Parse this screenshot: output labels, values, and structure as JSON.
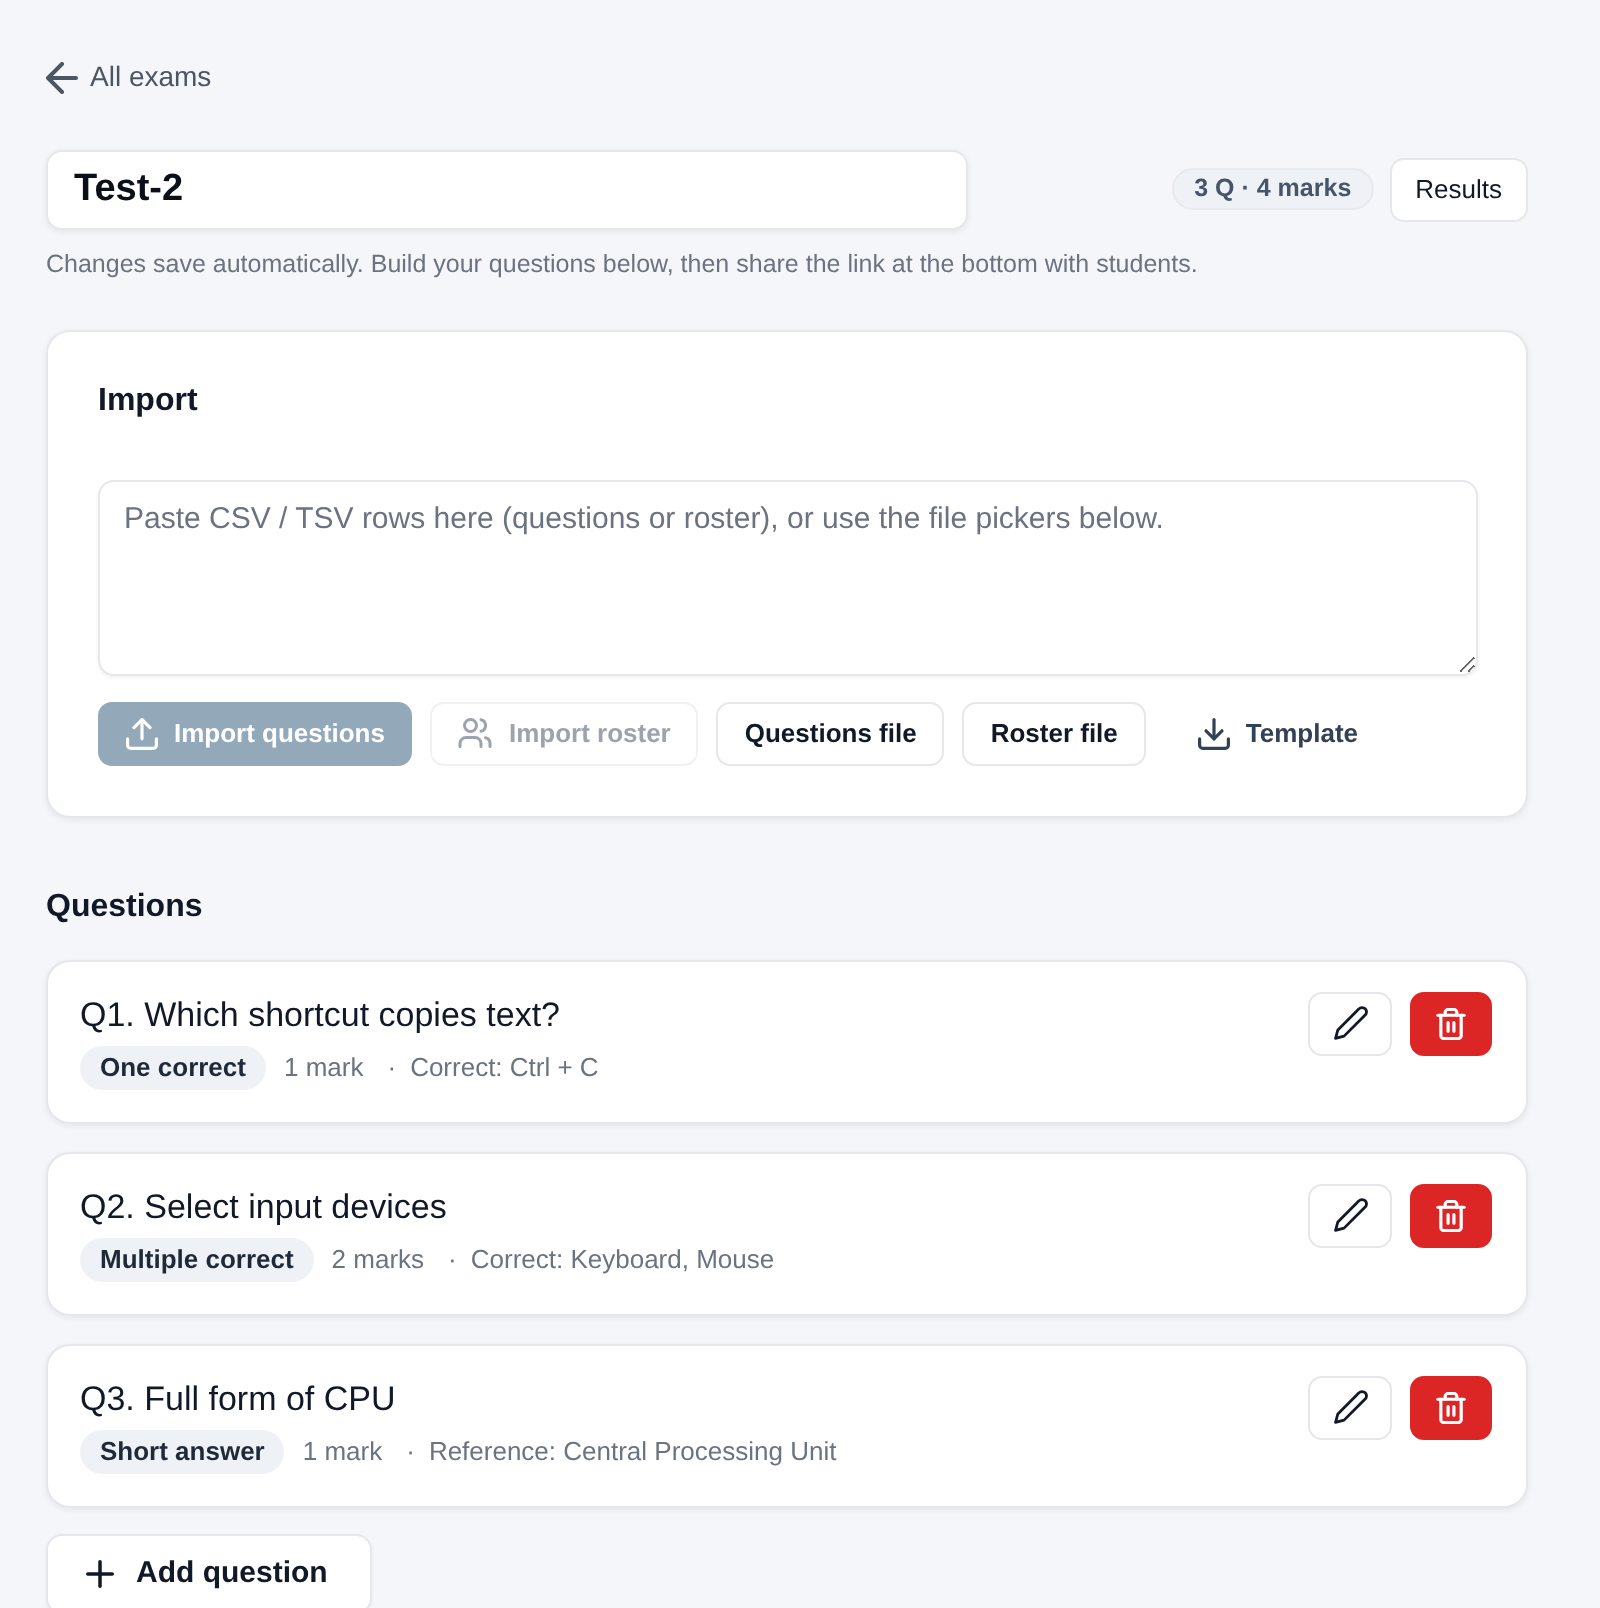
{
  "back_link": {
    "label": "All exams"
  },
  "exam": {
    "title": "Test-2",
    "summary": "3 Q · 4 marks",
    "results_button": "Results",
    "hint": "Changes save automatically. Build your questions below, then share the link at the bottom with students."
  },
  "import": {
    "heading": "Import",
    "placeholder": "Paste CSV / TSV rows here (questions or roster), or use the file pickers below.",
    "buttons": [
      {
        "label": "Import questions",
        "kind": "primary",
        "disabled": true
      },
      {
        "label": "Import roster",
        "kind": "secondary",
        "disabled": true
      },
      {
        "label": "Questions file",
        "kind": "outline",
        "disabled": false
      },
      {
        "label": "Roster file",
        "kind": "outline",
        "disabled": false
      },
      {
        "label": "Template",
        "kind": "link",
        "disabled": false
      }
    ]
  },
  "questions": {
    "heading": "Questions",
    "items": [
      {
        "title": "Q1. Which shortcut copies text?",
        "type": "One correct",
        "marks": "1 mark",
        "separator": "·",
        "detail": "Correct: Ctrl + C"
      },
      {
        "title": "Q2. Select input devices",
        "type": "Multiple correct",
        "marks": "2 marks",
        "separator": "·",
        "detail": "Correct: Keyboard, Mouse"
      },
      {
        "title": "Q3. Full form of CPU",
        "type": "Short answer",
        "marks": "1 mark",
        "separator": "·",
        "detail": "Reference: Central Processing Unit"
      }
    ]
  },
  "add_button": {
    "label": "Add question"
  }
}
